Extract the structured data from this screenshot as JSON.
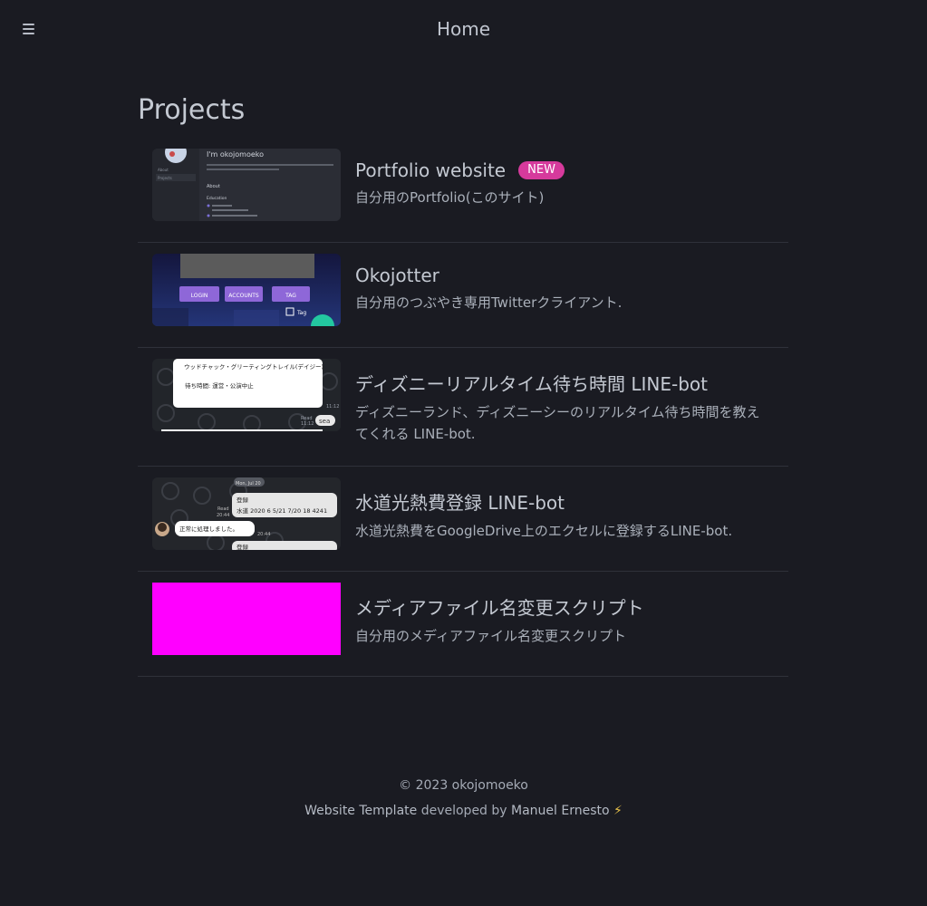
{
  "header": {
    "title": "Home"
  },
  "page": {
    "title": "Projects"
  },
  "projects": [
    {
      "title": "Portfolio website",
      "badge": "NEW",
      "description": "自分用のPortfolio(このサイト)"
    },
    {
      "title": "Okojotter",
      "badge": "",
      "description": "自分用のつぶやき専用Twitterクライアント."
    },
    {
      "title": "ディズニーリアルタイム待ち時間 LINE-bot",
      "badge": "",
      "description": "ディズニーランド、ディズニーシーのリアルタイム待ち時間を教えてくれる LINE-bot."
    },
    {
      "title": "水道光熱費登録 LINE-bot",
      "badge": "",
      "description": "水道光熱費をGoogleDrive上のエクセルに登録するLINE-bot."
    },
    {
      "title": "メディアファイル名変更スクリプト",
      "badge": "",
      "description": "自分用のメディアファイル名変更スクリプト"
    }
  ],
  "thumbnails": {
    "portfolio": {
      "heading": "I'm okojomoeko",
      "section": "About",
      "subsection": "Education",
      "nav_items": [
        "About",
        "Projects"
      ]
    },
    "okojotter": {
      "buttons": [
        "LOGIN",
        "ACCOUNTS",
        "TAG"
      ],
      "tag_label": "Tag"
    },
    "disney": {
      "attraction": "ウッドチャック・グリーティングトレイル(デイジー)",
      "wait": "待ち時間: 運営・公演中止",
      "time": "11:12",
      "read": "Read",
      "time2": "11:12",
      "bubble": "sea"
    },
    "utility": {
      "date": "Mon, Jul 20",
      "label1": "登録",
      "entry": "水道 2020 6 5/21 7/20 18 4241",
      "read": "Read",
      "time": "20:44",
      "reply": "正常に処理しました。",
      "time2": "20:44",
      "label2": "登録"
    }
  },
  "footer": {
    "copyright": "© 2023 okojomoeko",
    "template_link": "Website Template",
    "developed_by": " developed by ",
    "author_link": "Manuel Ernesto",
    "bolt": "⚡"
  },
  "colors": {
    "background": "#1a1b22",
    "badge": "#d63a9c",
    "placeholder_thumb": "#ff00ff"
  }
}
